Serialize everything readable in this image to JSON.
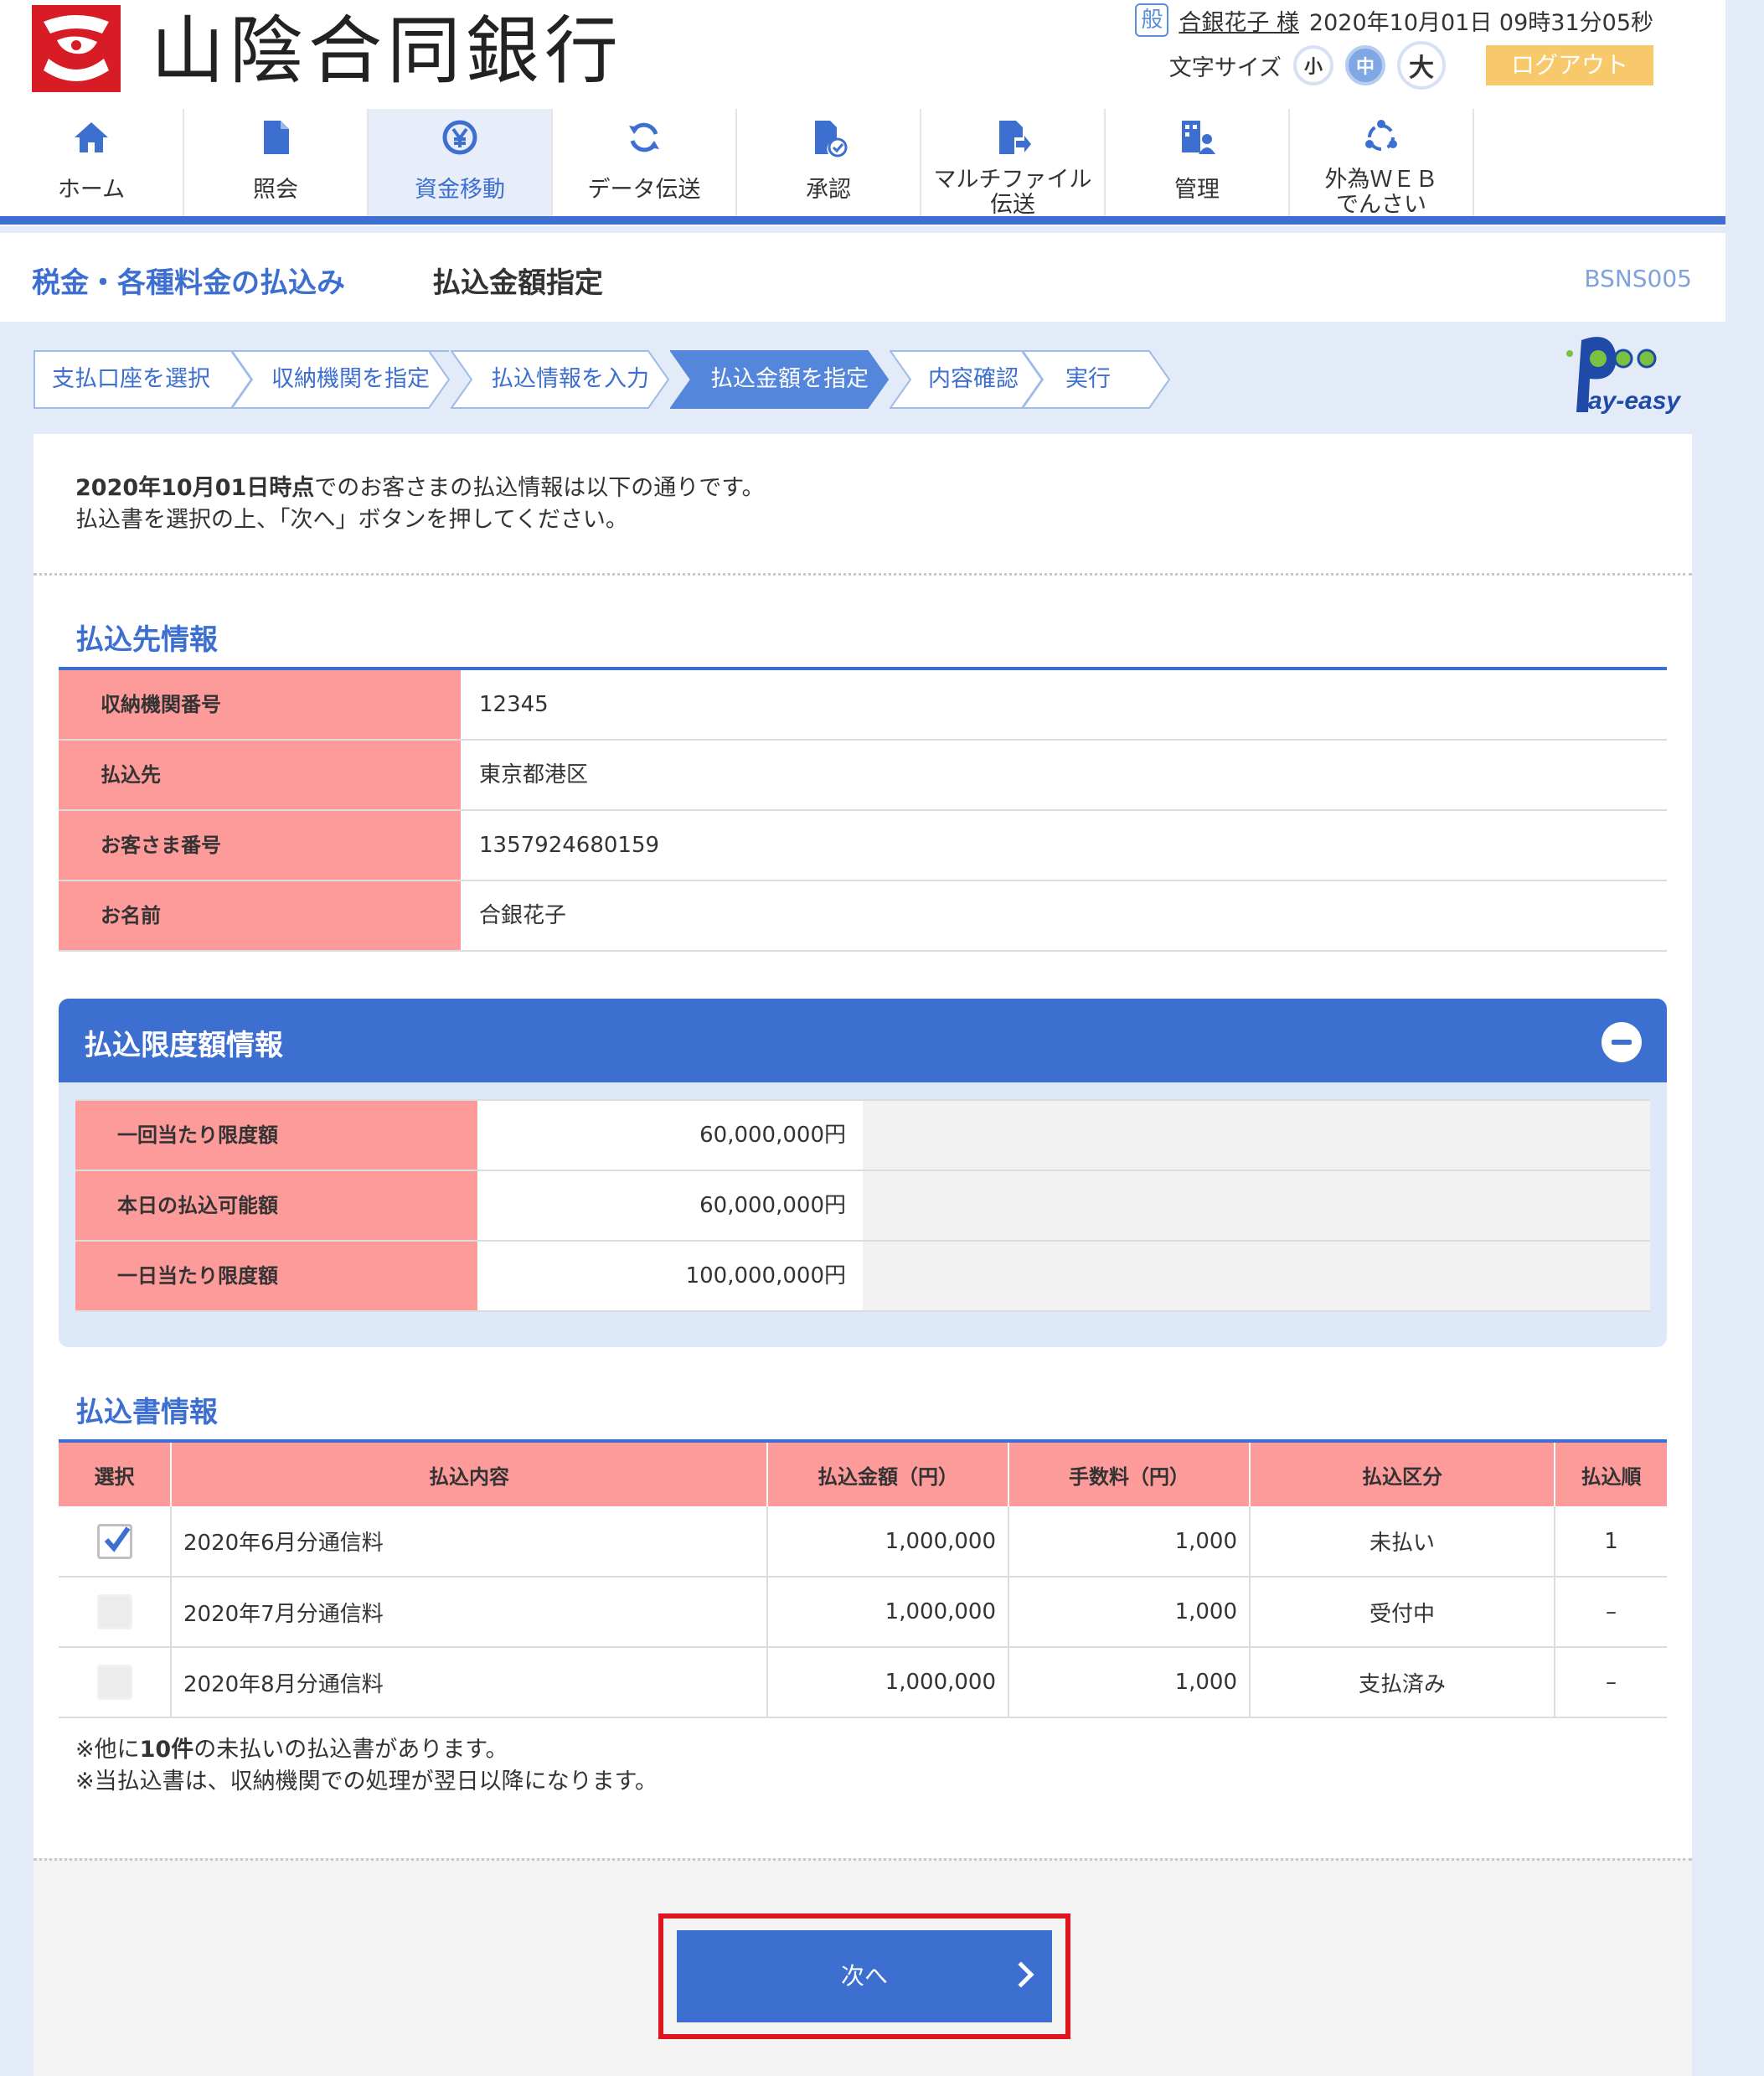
{
  "header": {
    "bank_name": "山陰合同銀行",
    "user_badge": "般",
    "user_name": "合銀花子 様",
    "datetime": "2020年10月01日 09時31分05秒",
    "font_size_label": "文字サイズ",
    "font_sizes": [
      "小",
      "中",
      "大"
    ],
    "logout": "ログアウト"
  },
  "nav": [
    {
      "label": "ホーム",
      "icon": "home-icon"
    },
    {
      "label": "照会",
      "icon": "document-icon"
    },
    {
      "label": "資金移動",
      "icon": "yen-transfer-icon"
    },
    {
      "label": "データ伝送",
      "icon": "sync-icon"
    },
    {
      "label": "承認",
      "icon": "approve-document-icon"
    },
    {
      "label": "マルチファイル伝送",
      "label_line1": "マルチファイル",
      "label_line2": "伝送",
      "icon": "file-send-icon"
    },
    {
      "label": "管理",
      "icon": "manage-user-icon"
    },
    {
      "label": "外為ＷＥＢでんさい",
      "label_line1": "外為ＷＥＢ",
      "label_line2": "でんさい",
      "icon": "network-icon"
    }
  ],
  "title": {
    "main": "税金・各種料金の払込み",
    "sub": "払込金額指定",
    "screen_id": "BSNS005"
  },
  "steps": [
    "支払口座を選択",
    "収納機関を指定",
    "払込情報を入力",
    "払込金額を指定",
    "内容確認",
    "実行"
  ],
  "intro": {
    "date_bold": "2020年10月01日時点",
    "line1_rest": "でのお客さまの払込情報は以下の通りです。",
    "line2": "払込書を選択の上、「次へ」ボタンを押してください。"
  },
  "payee": {
    "title": "払込先情報",
    "rows": [
      {
        "label": "収納機関番号",
        "value": "12345"
      },
      {
        "label": "払込先",
        "value": "東京都港区"
      },
      {
        "label": "お客さま番号",
        "value": "1357924680159"
      },
      {
        "label": "お名前",
        "value": "合銀花子"
      }
    ]
  },
  "limits": {
    "title": "払込限度額情報",
    "rows": [
      {
        "label": "一回当たり限度額",
        "value": "60,000,000円"
      },
      {
        "label": "本日の払込可能額",
        "value": "60,000,000円"
      },
      {
        "label": "一日当たり限度額",
        "value": "100,000,000円"
      }
    ]
  },
  "bills": {
    "title": "払込書情報",
    "headers": [
      "選択",
      "払込内容",
      "払込金額（円）",
      "手数料（円）",
      "払込区分",
      "払込順"
    ],
    "rows": [
      {
        "checked": true,
        "content": "2020年6月分通信料",
        "amount": "1,000,000",
        "fee": "1,000",
        "status": "未払い",
        "order": "1"
      },
      {
        "checked": false,
        "content": "2020年7月分通信料",
        "amount": "1,000,000",
        "fee": "1,000",
        "status": "受付中",
        "order": "–"
      },
      {
        "checked": false,
        "content": "2020年8月分通信料",
        "amount": "1,000,000",
        "fee": "1,000",
        "status": "支払済み",
        "order": "–"
      }
    ]
  },
  "notes": {
    "line1_pre": "※他に",
    "line1_bold": "10件",
    "line1_post": "の未払いの払込書があります。",
    "line2": "※当払込書は、収納機関での処理が翌日以降になります。"
  },
  "next_button": "次へ",
  "colors": {
    "accent": "#3c6fd0",
    "label_bg": "#fd9a9a",
    "logout": "#f7c96a",
    "brand_red": "#d81c26",
    "highlight_frame": "#e0141e"
  }
}
